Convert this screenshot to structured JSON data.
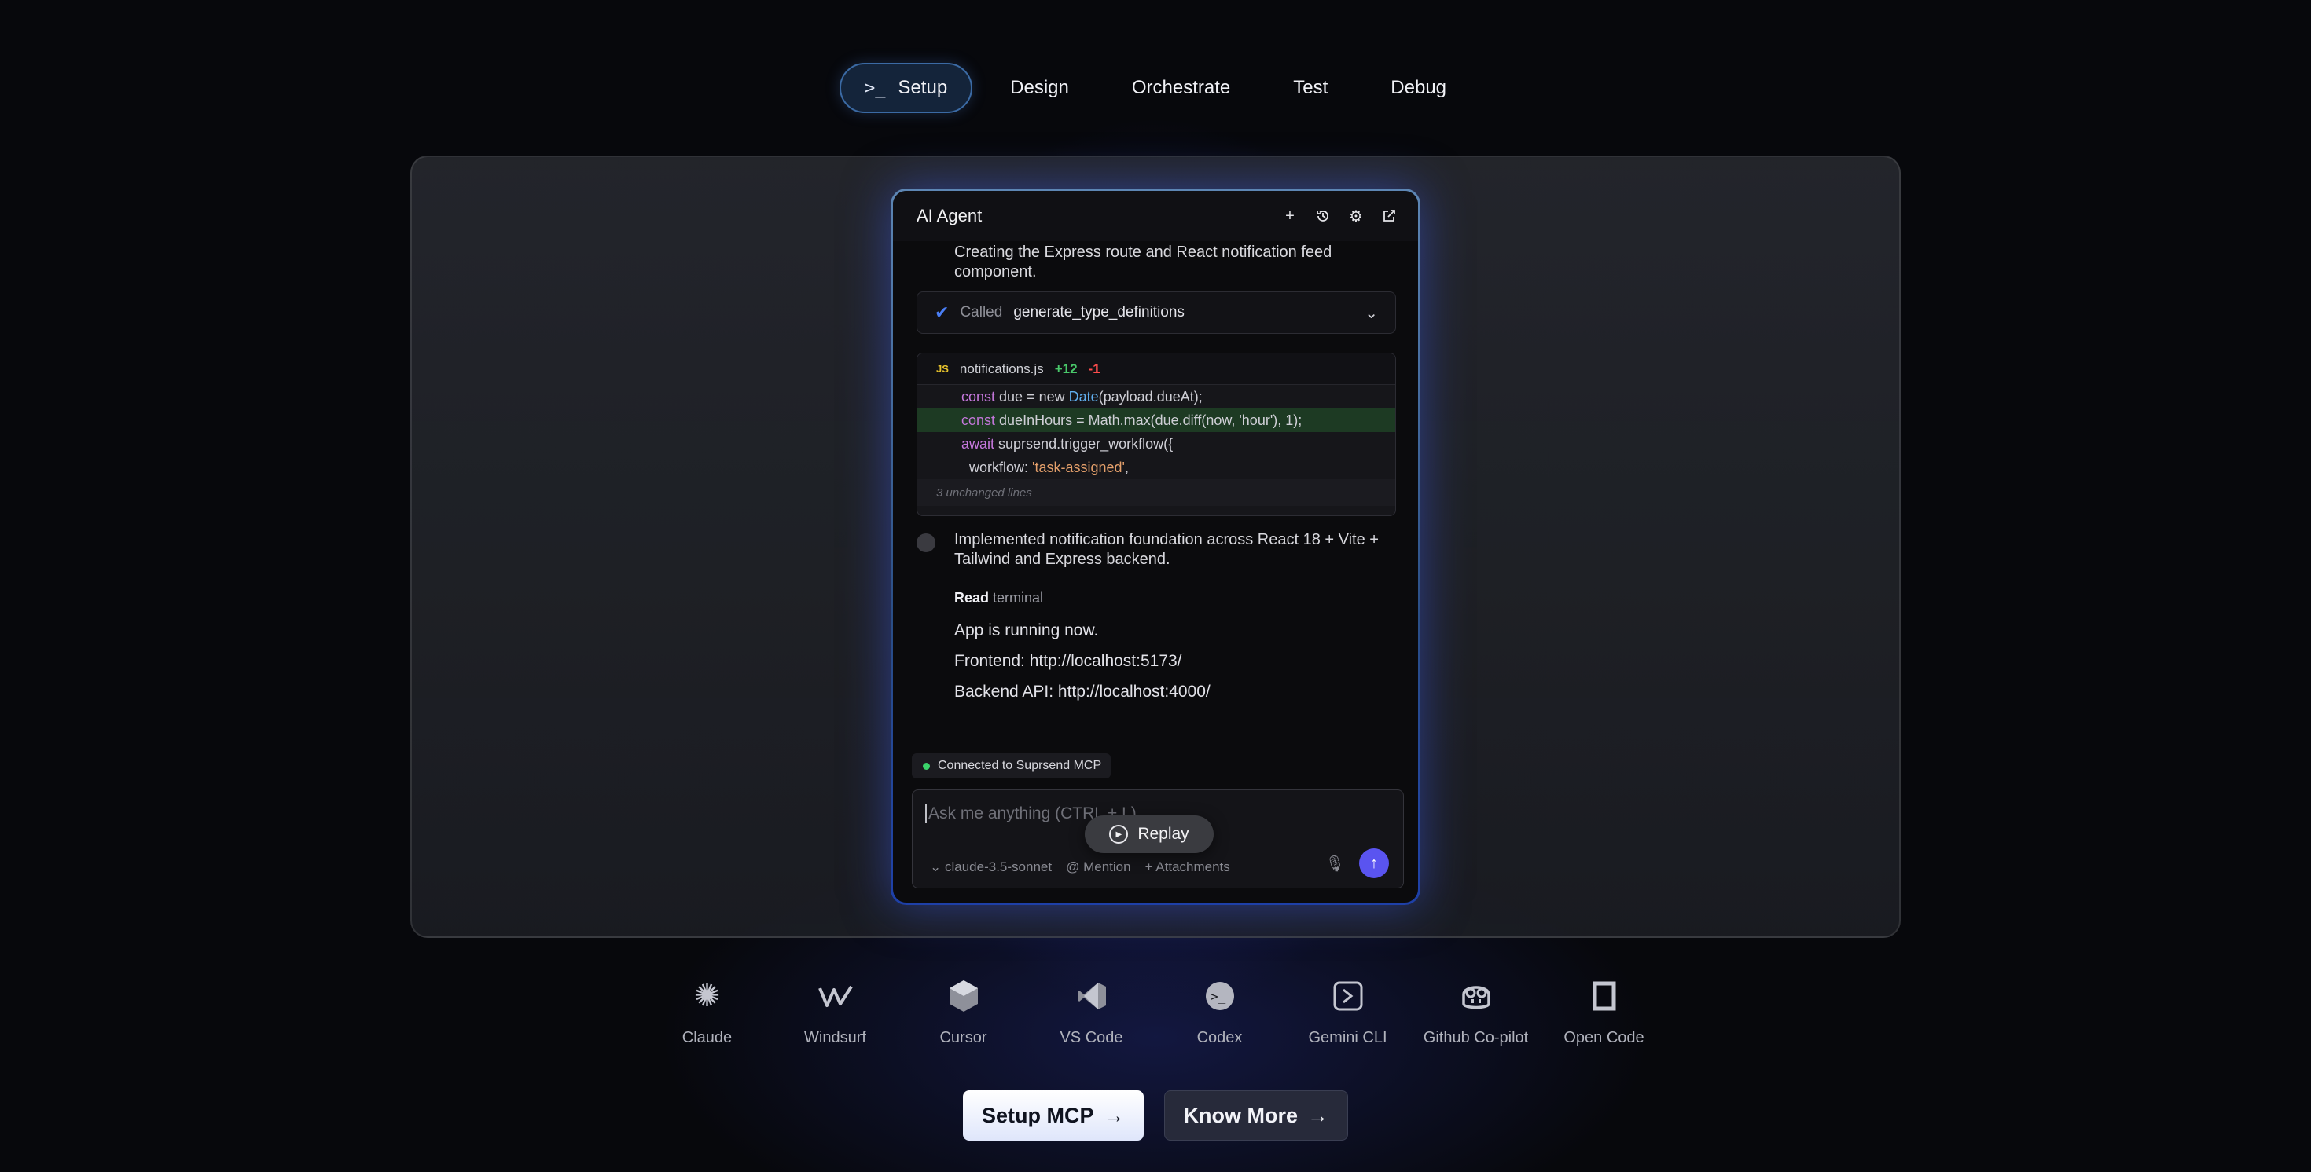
{
  "tabs": [
    {
      "label": "Setup",
      "icon": "terminal-icon",
      "active": true
    },
    {
      "label": "Design"
    },
    {
      "label": "Orchestrate"
    },
    {
      "label": "Test"
    },
    {
      "label": "Debug"
    }
  ],
  "panel": {
    "title": "AI Agent",
    "intro_text": "Creating the Express route and React notification feed component.",
    "called": {
      "label": "Called",
      "function": "generate_type_definitions"
    },
    "diff": {
      "badge": "JS",
      "file": "notifications.js",
      "added": "+12",
      "removed": "-1",
      "unchanged": "3 unchanged lines"
    },
    "summary": "Implemented notification foundation across React 18 + Vite + Tailwind and Express backend.",
    "read": {
      "verb": "Read",
      "target": "terminal"
    },
    "terminal_lines": [
      "App is running now.",
      "Frontend: http://localhost:5173/",
      "Backend API: http://localhost:4000/"
    ],
    "mcp_status": "Connected to Suprsend MCP",
    "input_placeholder": "Ask me anything (CTRL + L)",
    "model": "claude-3.5-sonnet",
    "mention": "Mention",
    "attachments": "Attachments",
    "replay": "Replay"
  },
  "tools": [
    {
      "name": "Claude",
      "icon": "claude-icon"
    },
    {
      "name": "Windsurf",
      "icon": "windsurf-icon"
    },
    {
      "name": "Cursor",
      "icon": "cursor-icon"
    },
    {
      "name": "VS Code",
      "icon": "vscode-icon"
    },
    {
      "name": "Codex",
      "icon": "codex-icon"
    },
    {
      "name": "Gemini CLI",
      "icon": "gemini-cli-icon"
    },
    {
      "name": "Github Co-pilot",
      "icon": "github-copilot-icon"
    },
    {
      "name": "Open Code",
      "icon": "open-code-icon"
    }
  ],
  "cta": {
    "primary": "Setup MCP",
    "secondary": "Know More"
  },
  "colors": {
    "accent": "#5a54f0",
    "background": "#07080c",
    "success": "#3ad36a"
  }
}
